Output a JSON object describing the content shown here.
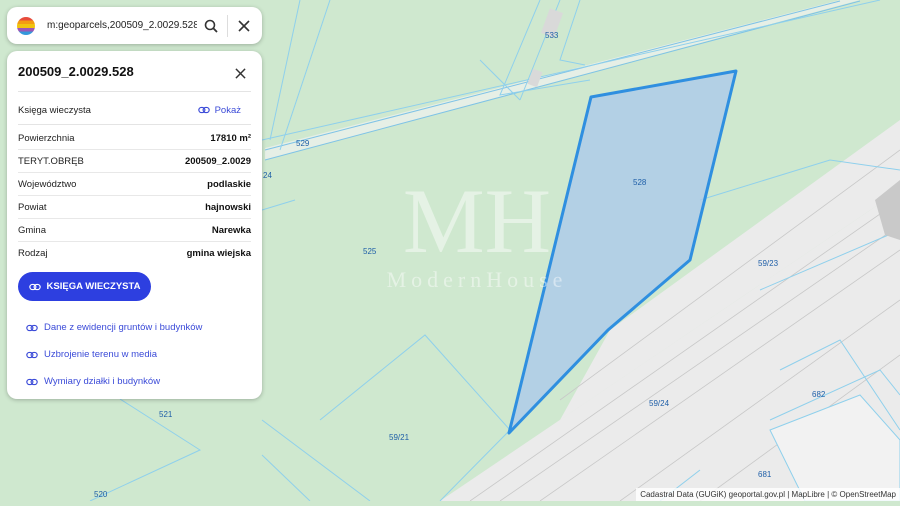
{
  "search": {
    "value": "m:geoparcels,200509_2.0029.528"
  },
  "panel": {
    "title": "200509_2.0029.528",
    "ksiega_label": "Księga wieczysta",
    "ksiega_link": "Pokaż",
    "attributes": [
      {
        "label": "Powierzchnia",
        "value": "17810 m²"
      },
      {
        "label": "TERYT.OBRĘB",
        "value": "200509_2.0029"
      },
      {
        "label": "Województwo",
        "value": "podlaskie"
      },
      {
        "label": "Powiat",
        "value": "hajnowski"
      },
      {
        "label": "Gmina",
        "value": "Narewka"
      },
      {
        "label": "Rodzaj",
        "value": "gmina wiejska"
      }
    ],
    "primary_button": "KSIĘGA WIECZYSTA",
    "links": [
      "Dane z ewidencji gruntów i budynków",
      "Uzbrojenie terenu w media",
      "Wymiary działki i budynków"
    ]
  },
  "map": {
    "parcel_labels": [
      "533",
      "529",
      "528",
      "525",
      "59/23",
      "24",
      "521",
      "59/21",
      "59/24",
      "682",
      "681",
      "520"
    ],
    "selected_parcel": "528",
    "selected_fill": "#a9c8ec",
    "selected_stroke": "#2f8fe0",
    "accent": "#2d3fe0"
  },
  "watermark": {
    "mark": "MH",
    "text": "ModernHouse"
  },
  "attribution": "Cadastral Data (GUGiK) geoportal.gov.pl | MapLibre | © OpenStreetMap"
}
